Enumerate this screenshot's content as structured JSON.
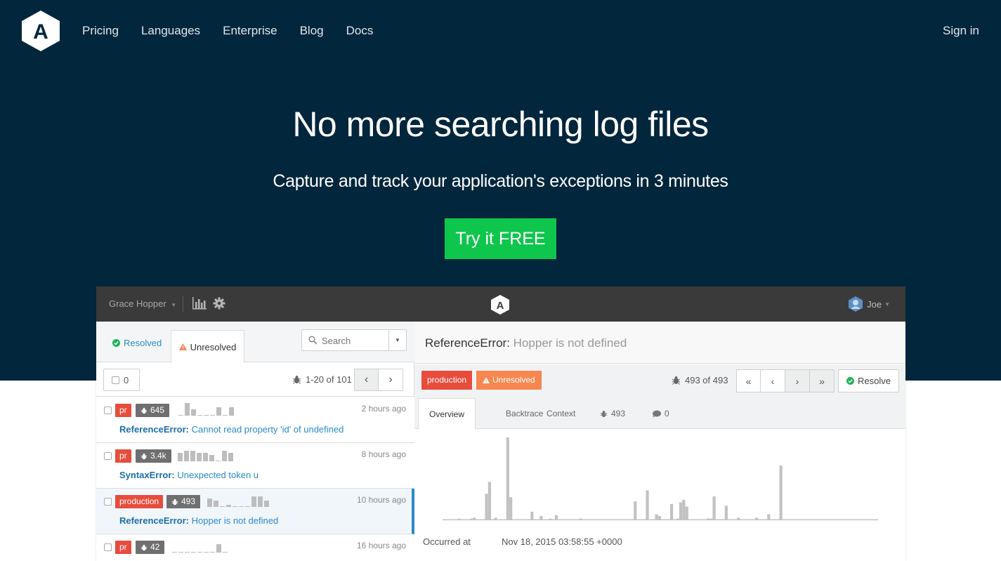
{
  "nav": {
    "links": [
      "Pricing",
      "Languages",
      "Enterprise",
      "Blog",
      "Docs"
    ],
    "sign_in": "Sign in",
    "logo_letter": "A"
  },
  "hero": {
    "headline": "No more searching log files",
    "subhead": "Capture and track your application's exceptions in 3 minutes",
    "cta": "Try it FREE"
  },
  "app": {
    "org_name": "Grace Hopper",
    "user_name": "Joe",
    "logo_letter": "A",
    "tabs": {
      "resolved": "Resolved",
      "unresolved": "Unresolved"
    },
    "search": {
      "placeholder": "Search"
    },
    "list": {
      "selected_count": "0",
      "range": "1-20 of 101",
      "rows": [
        {
          "env": "pr",
          "count": "645",
          "time": "2 hours ago",
          "error_type": "ReferenceError:",
          "message": "Cannot read property 'id' of undefined",
          "spark": [
            0,
            6,
            3,
            0,
            0,
            0,
            4,
            0,
            4
          ]
        },
        {
          "env": "pr",
          "count": "3.4k",
          "time": "8 hours ago",
          "error_type": "SyntaxError:",
          "message": "Unexpected token u",
          "spark": [
            4,
            5,
            5,
            4,
            4,
            3,
            0,
            5,
            4
          ]
        },
        {
          "env": "production",
          "count": "493",
          "time": "10 hours ago",
          "error_type": "ReferenceError:",
          "message": "Hopper is not defined",
          "spark": [
            4,
            3,
            0,
            1,
            0,
            0,
            0,
            5,
            5,
            3
          ]
        },
        {
          "env": "pr",
          "count": "42",
          "time": "16 hours ago",
          "error_type": "",
          "message": "",
          "spark": [
            0,
            0,
            0,
            0,
            0,
            0,
            0,
            4,
            0
          ]
        }
      ]
    },
    "detail": {
      "error_type": "ReferenceError:",
      "message": "Hopper is not defined",
      "env": "production",
      "status": "Unresolved",
      "occurrence": "493 of 493",
      "resolve": "Resolve",
      "tabs": [
        "Overview",
        "Backtrace",
        "Context"
      ],
      "occurrences_tab": "493",
      "comments_tab": "0",
      "occurred_label": "Occurred at",
      "occurred_value": "Nov 18, 2015 03:58:55 +0000",
      "histogram": [
        1,
        1,
        1,
        1,
        1,
        2,
        1,
        1,
        1,
        2,
        3,
        1,
        1,
        1,
        31,
        45,
        1,
        3,
        1,
        1,
        1,
        97,
        27,
        1,
        1,
        1,
        1,
        1,
        1,
        10,
        1,
        1,
        5,
        1,
        1,
        2,
        1,
        6,
        1,
        1,
        1,
        1,
        1,
        1,
        1,
        2,
        1,
        1,
        1,
        1,
        1,
        1,
        1,
        1,
        1,
        1,
        1,
        1,
        1,
        1,
        1,
        1,
        1,
        22,
        1,
        1,
        1,
        35,
        1,
        1,
        7,
        5,
        1,
        1,
        1,
        19,
        1,
        2,
        21,
        24,
        16,
        1,
        1,
        1,
        1,
        1,
        1,
        2,
        2,
        28,
        1,
        1,
        1,
        17,
        1,
        1,
        1,
        3,
        1,
        1,
        1,
        1,
        1,
        3,
        1,
        1,
        1,
        7,
        1,
        1,
        1,
        64,
        1,
        1,
        1,
        1,
        1,
        1,
        1,
        1,
        1,
        1,
        1,
        1,
        1,
        1,
        1,
        1,
        1,
        1,
        1,
        1,
        1,
        1,
        1,
        1,
        1,
        1,
        1,
        1,
        1,
        1,
        1,
        1
      ]
    }
  }
}
